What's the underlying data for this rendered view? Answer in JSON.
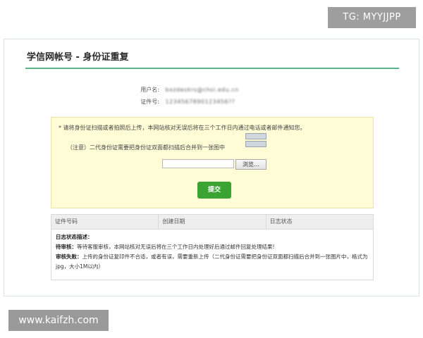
{
  "watermarks": {
    "top": "TG: MYYJJPP",
    "bottom": "www.kaifzh.com"
  },
  "page": {
    "title": "学信网帐号 - 身份证重复"
  },
  "account": {
    "username_label": "用户名:",
    "username_value": "bxzdeskrs@chsi.edu.cn",
    "id_label": "证件号:",
    "id_value": "1234567890123456??"
  },
  "upload": {
    "notice": "* 请将身份证扫描或者拍照后上传，本网站核对无误后将在三个工作日内通过电话或者邮件通知您。",
    "note": "（注意）二代身份证需要把身份证双面都扫描后合并到一张图中",
    "browse_label": "浏览…",
    "submit_label": "提交"
  },
  "log_table": {
    "headers": [
      "证件号码",
      "创建日期",
      "日志状态"
    ],
    "desc_title": "日志状态描述：",
    "pending_label": "待审核：",
    "pending_text": "等待客服审核，本网站核对无误后将在三个工作日内处理好后通过邮件回复处理结果!",
    "failed_label": "审核失败：",
    "failed_text": "上传的身份证复印件不合适，或者有误，需要重新上传（二代身份证需要把身份证双面都扫描后合并到一张图片中，格式为jpg，大小1M以内）"
  },
  "colors": {
    "accent_rule": "#5ab48a",
    "submit_green": "#3aa332",
    "upload_bg": "#fffcd6"
  }
}
